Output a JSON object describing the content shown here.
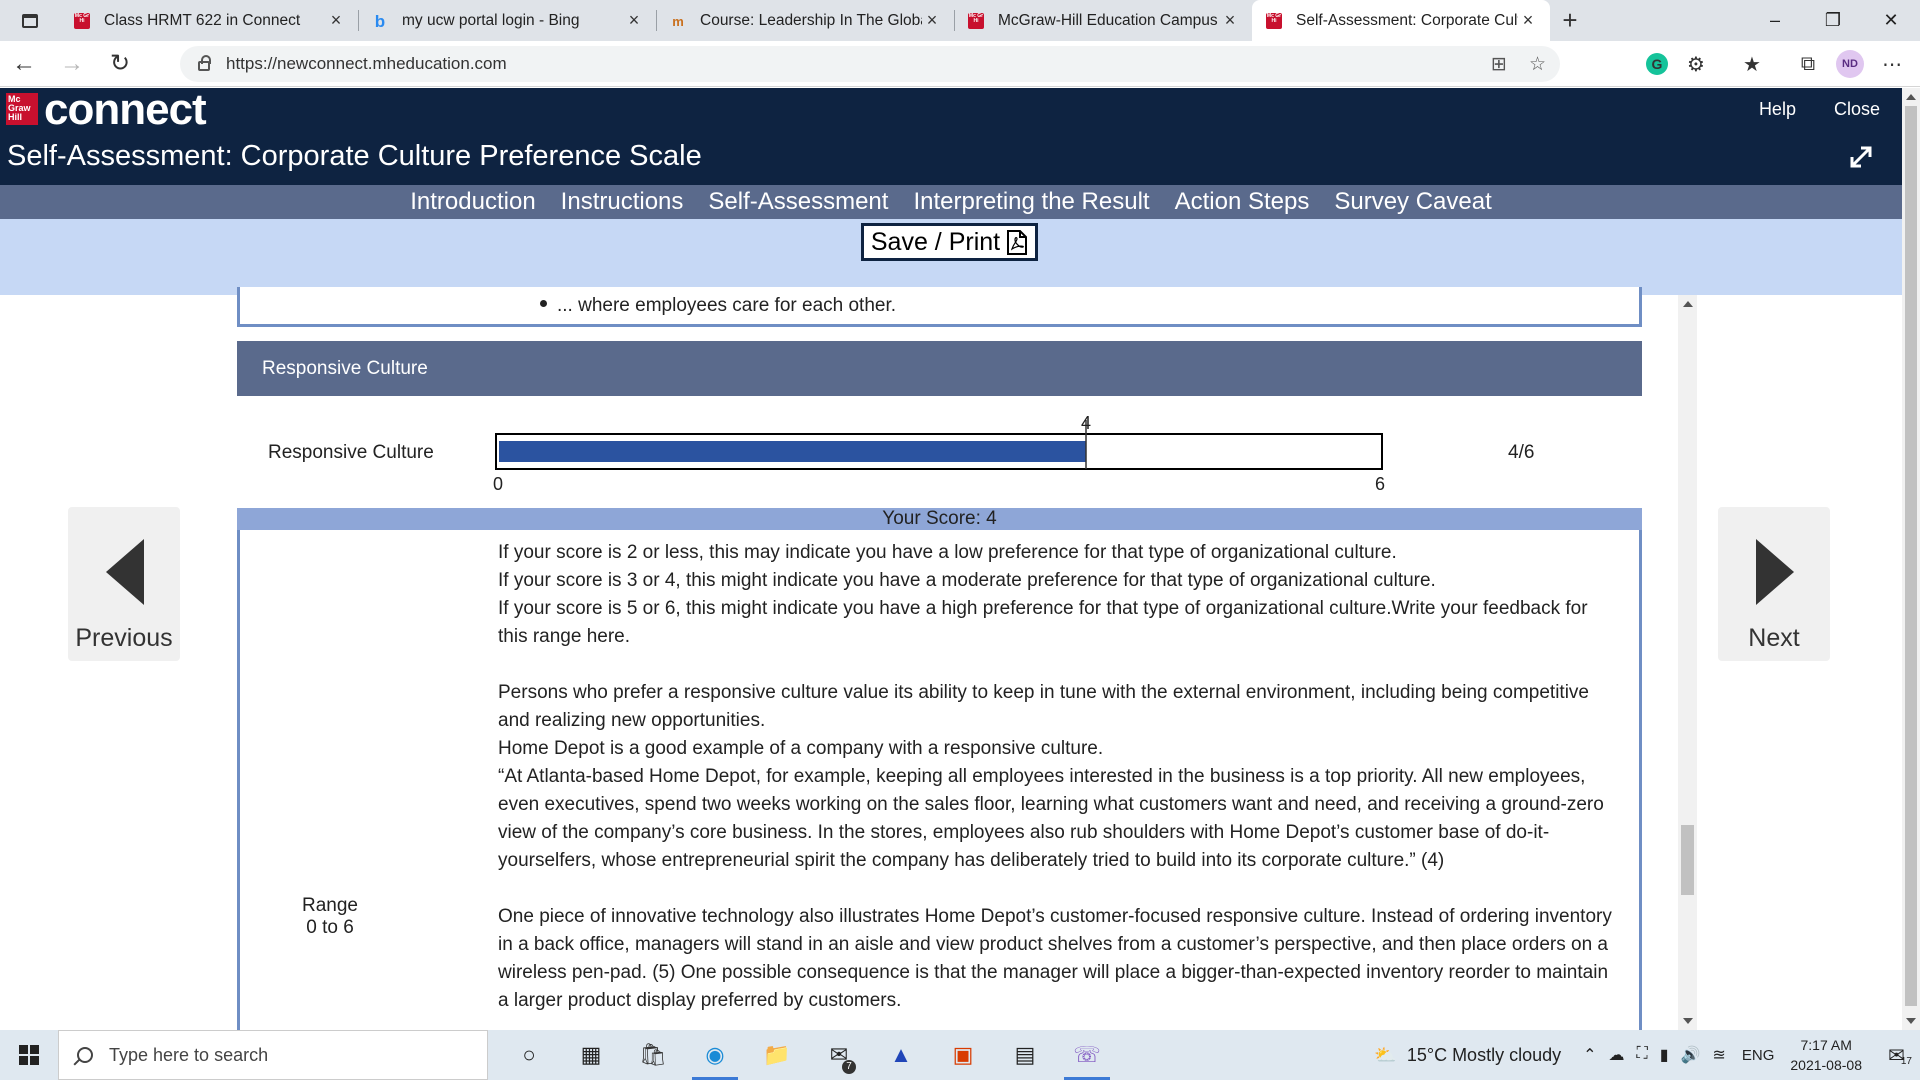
{
  "browser": {
    "tabs": [
      {
        "title": "Class HRMT 622 in Connect",
        "icon": "mcgraw-hill-favicon"
      },
      {
        "title": "my ucw portal login - Bing",
        "icon": "bing-favicon"
      },
      {
        "title": "Course: Leadership In The Global",
        "icon": "moodle-favicon"
      },
      {
        "title": "McGraw-Hill Education Campus",
        "icon": "mcgraw-hill-favicon"
      },
      {
        "title": "Self-Assessment: Corporate Culture",
        "icon": "mcgraw-hill-favicon"
      }
    ],
    "url": "https://newconnect.mheducation.com",
    "profile_initials": "ND",
    "grammarly_glyph": "G",
    "new_tab_glyph": "+",
    "close_glyph": "×"
  },
  "app": {
    "logo_text": "connect",
    "logo_mark": "Mc Graw Hill",
    "help_label": "Help",
    "close_label": "Close",
    "title": "Self-Assessment: Corporate Culture Preference Scale",
    "nav": [
      "Introduction",
      "Instructions",
      "Self-Assessment",
      "Interpreting the Result",
      "Action Steps",
      "Survey Caveat"
    ],
    "save_label": "Save / Print"
  },
  "content": {
    "prev_bullet": "... where employees care for each other.",
    "section_title": "Responsive Culture",
    "score_label": "Responsive Culture",
    "score_value": 4,
    "score_min": 0,
    "score_max": 6,
    "score_marker": "4",
    "score_min_label": "0",
    "score_max_label": "6",
    "score_fraction": "4/6",
    "your_score": "Your Score: 4",
    "range_label": "Range",
    "range_value": "0 to 6",
    "feedback_lines": [
      "If your score is 2 or less, this may indicate you have a low preference for that type of organizational culture.",
      "If your score is 3 or 4, this might indicate you have a moderate preference for that type of organizational culture.",
      "If your score is 5 or 6, this might indicate you have a high preference for that type of organizational culture.Write your feedback for this range here."
    ],
    "paragraphs": [
      "Persons who prefer a responsive culture value its ability to keep in tune with the external environment, including being competitive and realizing new opportunities.",
      "Home Depot is a good example of a company with a responsive culture.",
      "“At Atlanta-based Home Depot, for example, keeping all employees interested in the business is a top priority. All new employees, even executives, spend two weeks working on the sales floor, learning what customers want and need, and receiving a ground-zero view of the company’s core business. In the stores, employees also rub shoulders with Home Depot’s customer base of do-it-yourselfers, whose entrepreneurial spirit the company has deliberately tried to build into its corporate culture.” (4)",
      "One piece of innovative technology also illustrates Home Depot’s customer-focused responsive culture. Instead of ordering inventory in a back office, managers will stand in an aisle and view product shelves from a customer’s perspective, and then place orders on a wireless pen-pad. (5) One possible consequence is that the manager will place a bigger-than-expected inventory reorder to maintain a larger product display preferred by customers."
    ],
    "previous_label": "Previous",
    "next_label": "Next"
  },
  "taskbar": {
    "search_placeholder": "Type here to search",
    "weather": "15°C  Mostly cloudy",
    "lang": "ENG",
    "time": "7:17 AM",
    "date": "2021-08-08",
    "mail_badge": "7",
    "notif_count": "17"
  },
  "colors": {
    "connect_navy": "#0e2341",
    "nav_slate": "#5a6a8c",
    "save_band": "#c6d8f5",
    "bar_fill": "#2b53a0",
    "score_strip": "#8ea6d7",
    "box_border": "#6f8ec4"
  }
}
